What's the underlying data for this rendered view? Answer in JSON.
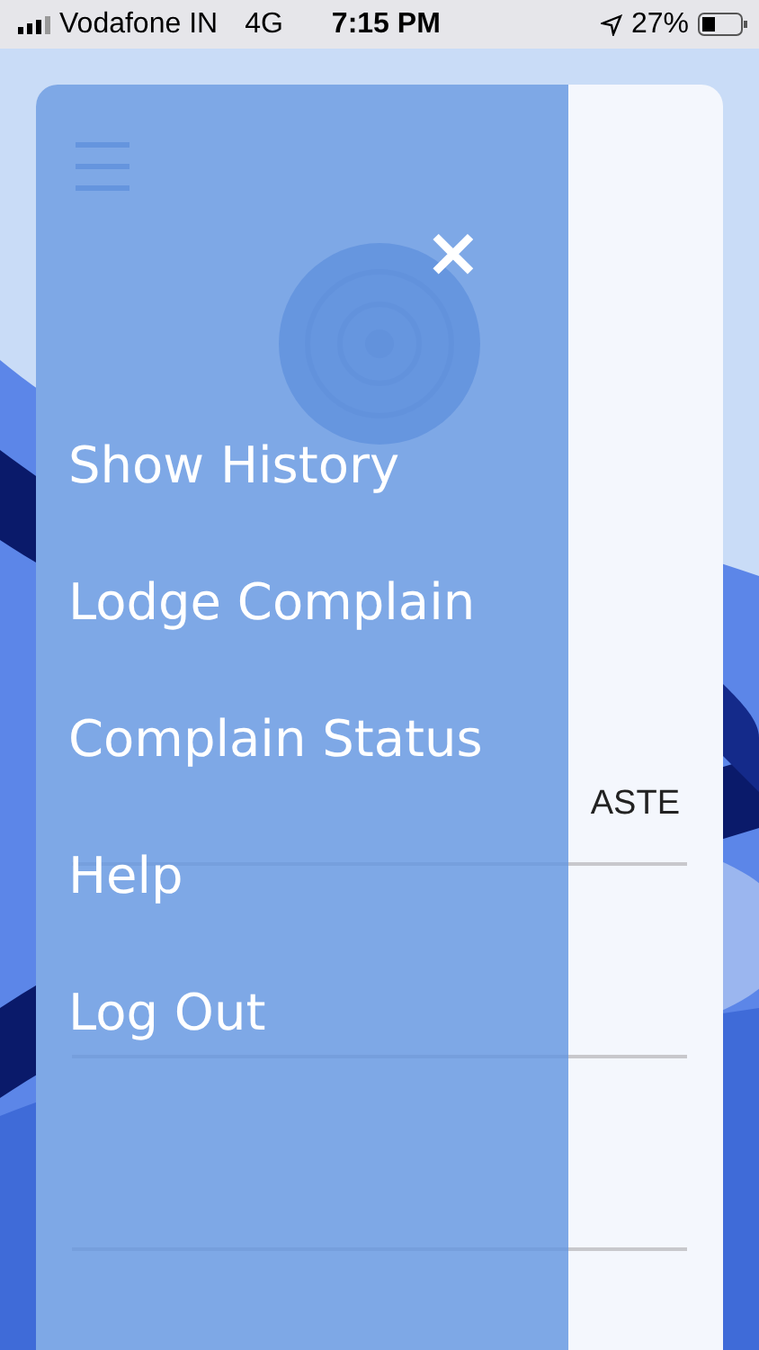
{
  "status_bar": {
    "carrier": "Vodafone IN",
    "network": "4G",
    "time": "7:15 PM",
    "battery": "27%"
  },
  "page": {
    "visible_value": "ASTE"
  },
  "menu": {
    "close": "×",
    "items": [
      {
        "label": "Show History"
      },
      {
        "label": "Lodge Complain"
      },
      {
        "label": "Complain Status"
      },
      {
        "label": "Help"
      },
      {
        "label": "Log Out"
      }
    ]
  }
}
